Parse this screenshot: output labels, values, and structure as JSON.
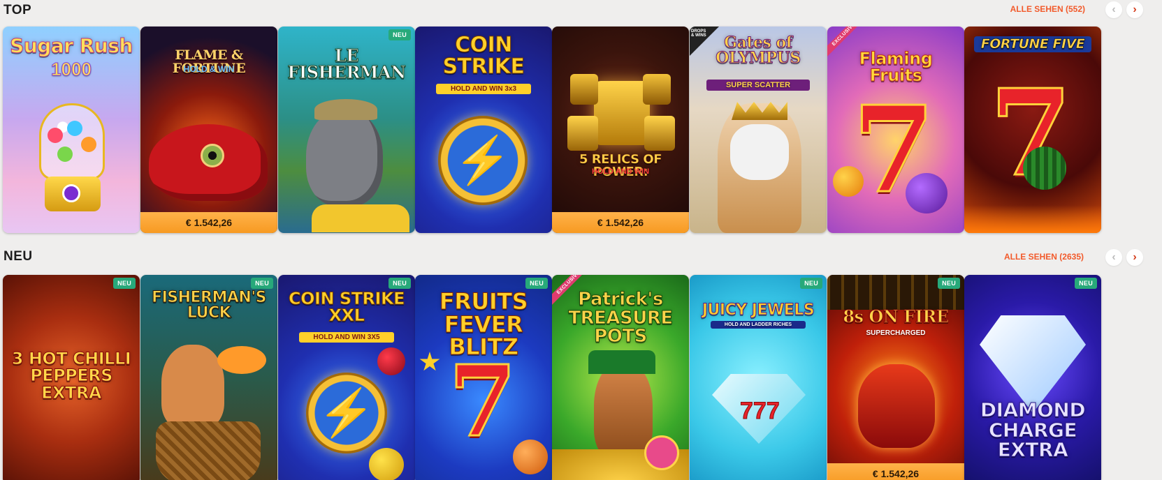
{
  "sections": [
    {
      "title": "TOP",
      "see_all": "ALLE SEHEN (552)",
      "games": [
        {
          "title": "Sugar Rush",
          "subtitle": "1000",
          "jackpot": "",
          "badge": ""
        },
        {
          "title": "FLAME & FORTUNE",
          "subtitle": "HOLD & WIN",
          "jackpot": "€ 1.542,26",
          "badge": ""
        },
        {
          "title": "LE FISHERMAN",
          "subtitle": "",
          "jackpot": "",
          "badge": "NEU"
        },
        {
          "title": "COIN STRIKE",
          "subtitle": "HOLD AND WIN 3x3",
          "jackpot": "",
          "badge": ""
        },
        {
          "title": "5 RELICS OF POWER:",
          "subtitle": "HOLD AND WIN",
          "jackpot": "€ 1.542,26",
          "badge": ""
        },
        {
          "title": "Gates of OLYMPUS",
          "subtitle": "SUPER SCATTER",
          "jackpot": "",
          "badge": "DROPS & WINS"
        },
        {
          "title": "Flaming Fruits",
          "subtitle": "",
          "jackpot": "",
          "badge": "EXCLUSIVE"
        },
        {
          "title": "FORTUNE FIVE",
          "subtitle": "",
          "jackpot": "",
          "badge": ""
        }
      ]
    },
    {
      "title": "NEU",
      "see_all": "ALLE SEHEN (2635)",
      "games": [
        {
          "title": "3 HOT CHILLI PEPPERS EXTRA",
          "subtitle": "",
          "jackpot": "",
          "badge": "NEU"
        },
        {
          "title": "FISHERMAN'S LUCK",
          "subtitle": "",
          "jackpot": "",
          "badge": "NEU"
        },
        {
          "title": "COIN STRIKE XXL",
          "subtitle": "HOLD AND WIN 3X5",
          "jackpot": "",
          "badge": "NEU"
        },
        {
          "title": "FRUITS FEVER BLITZ",
          "subtitle": "",
          "jackpot": "",
          "badge": "NEU"
        },
        {
          "title": "Patrick's TREASURE POTS",
          "subtitle": "",
          "jackpot": "",
          "badge": "EXCLUSIVE"
        },
        {
          "title": "JUICY JEWELS",
          "subtitle": "HOLD AND LADDER RICHES",
          "jackpot": "",
          "badge": "NEU"
        },
        {
          "title": "8s ON FIRE",
          "subtitle": "SUPERCHARGED",
          "jackpot": "€ 1.542,26",
          "badge": "NEU"
        },
        {
          "title": "DIAMOND CHARGE EXTRA",
          "subtitle": "",
          "jackpot": "",
          "badge": "NEU"
        }
      ]
    }
  ],
  "icons": {
    "prev": "chevron-left-icon",
    "next": "chevron-right-icon"
  },
  "colors": {
    "accent": "#f25a2b",
    "new_badge": "#27a97a",
    "jackpot": "#f79a22",
    "exclusive": "#e03b6e"
  }
}
